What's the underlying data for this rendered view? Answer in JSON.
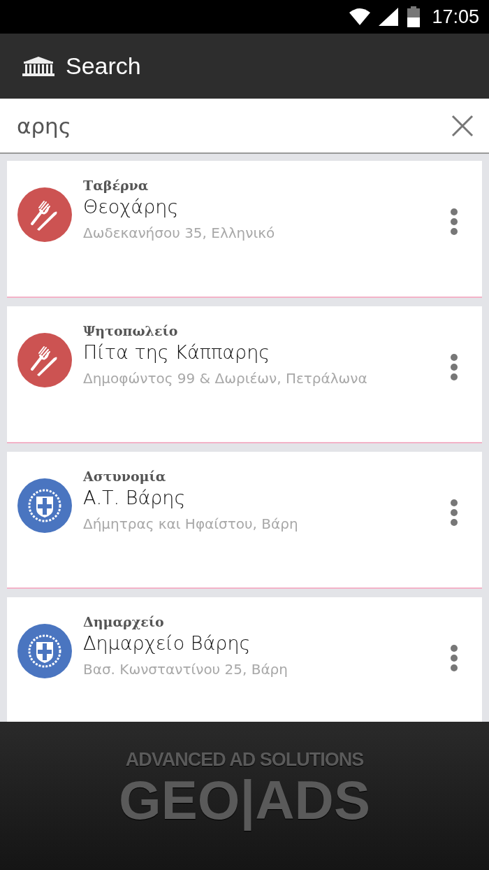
{
  "status_bar": {
    "time": "17:05"
  },
  "app_bar": {
    "title": "Search"
  },
  "search": {
    "value": "αρης"
  },
  "results": [
    {
      "kind": "food",
      "category": "Ταβέρνα",
      "name": "Θεοχάρης",
      "address": "Δωδεκανήσου 35, Ελληνικό"
    },
    {
      "kind": "food",
      "category": "Ψητοπωλείο",
      "name": "Πίτα της Κάππαρης",
      "address": "Δημοφώντος 99 & Δωριέων, Πετράλωνα"
    },
    {
      "kind": "government",
      "category": "Αστυνομία",
      "name": "Α.Τ. Βάρης",
      "address": "Δήμητρας και Ηφαίστου, Βάρη"
    },
    {
      "kind": "government",
      "category": "Δημαρχείο",
      "name": "Δημαρχείο Βάρης",
      "address": "Βασ. Κωνσταντίνου 25, Βάρη"
    }
  ],
  "ad_banner": {
    "tagline": "ADVANCED AD SOLUTIONS",
    "brand": "GEO|ADS"
  }
}
